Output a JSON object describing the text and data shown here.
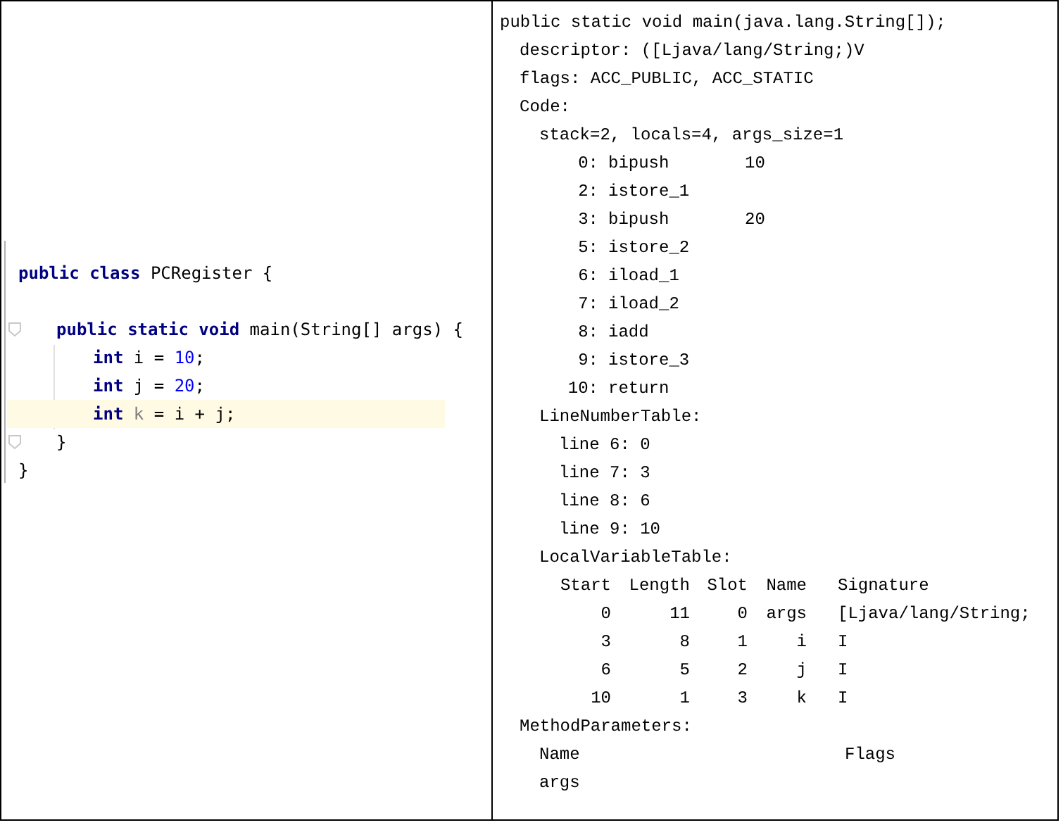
{
  "source_editor": {
    "lines": [
      {
        "kind": "top",
        "highlighted": false,
        "tokens": [
          {
            "text": "public ",
            "kind": "keyword"
          },
          {
            "text": "class ",
            "kind": "keyword"
          },
          {
            "text": "PCRegister {",
            "kind": "plain"
          }
        ]
      },
      {
        "kind": "blank",
        "highlighted": false
      },
      {
        "kind": "member",
        "highlighted": false,
        "fold": true,
        "tokens": [
          {
            "text": "public ",
            "kind": "keyword"
          },
          {
            "text": "static ",
            "kind": "keyword"
          },
          {
            "text": "void ",
            "kind": "keyword"
          },
          {
            "text": "main(String[] args) {",
            "kind": "plain"
          }
        ]
      },
      {
        "kind": "statement",
        "highlighted": false,
        "tokens": [
          {
            "text": "int ",
            "kind": "keyword"
          },
          {
            "text": "i = ",
            "kind": "plain"
          },
          {
            "text": "10",
            "kind": "number"
          },
          {
            "text": ";",
            "kind": "plain"
          }
        ]
      },
      {
        "kind": "statement",
        "highlighted": false,
        "tokens": [
          {
            "text": "int ",
            "kind": "keyword"
          },
          {
            "text": "j = ",
            "kind": "plain"
          },
          {
            "text": "20",
            "kind": "number"
          },
          {
            "text": ";",
            "kind": "plain"
          }
        ]
      },
      {
        "kind": "statement",
        "highlighted": true,
        "tokens": [
          {
            "text": "int ",
            "kind": "keyword"
          },
          {
            "text": "k",
            "kind": "unused"
          },
          {
            "text": " = i + j;",
            "kind": "plain"
          }
        ]
      },
      {
        "kind": "member",
        "highlighted": false,
        "fold": true,
        "tokens": [
          {
            "text": "}",
            "kind": "plain"
          }
        ]
      },
      {
        "kind": "top",
        "highlighted": false,
        "tokens": [
          {
            "text": "}",
            "kind": "plain"
          }
        ]
      }
    ]
  },
  "bytecode": {
    "signature": "public static void main(java.lang.String[]);",
    "attributes": [
      "descriptor: ([Ljava/lang/String;)V",
      "flags: ACC_PUBLIC, ACC_STATIC"
    ],
    "code": {
      "title": "Code:",
      "header": "stack=2, locals=4, args_size=1",
      "instructions": [
        {
          "offset": "0:",
          "opcode": "bipush",
          "operand": "10"
        },
        {
          "offset": "2:",
          "opcode": "istore_1"
        },
        {
          "offset": "3:",
          "opcode": "bipush",
          "operand": "20"
        },
        {
          "offset": "5:",
          "opcode": "istore_2"
        },
        {
          "offset": "6:",
          "opcode": "iload_1"
        },
        {
          "offset": "7:",
          "opcode": "iload_2"
        },
        {
          "offset": "8:",
          "opcode": "iadd"
        },
        {
          "offset": "9:",
          "opcode": "istore_3"
        },
        {
          "offset": "10:",
          "opcode": "return"
        }
      ],
      "line_number_table": {
        "title": "LineNumberTable:",
        "entries": [
          "line 6: 0",
          "line 7: 3",
          "line 8: 6",
          "line 9: 10"
        ]
      },
      "local_variable_table": {
        "title": "LocalVariableTable:",
        "columns": [
          "Start",
          "Length",
          "Slot",
          "Name",
          "Signature"
        ],
        "rows": [
          [
            "0",
            "11",
            "0",
            "args",
            "[Ljava/lang/String;"
          ],
          [
            "3",
            "8",
            "1",
            "i",
            "I"
          ],
          [
            "6",
            "5",
            "2",
            "j",
            "I"
          ],
          [
            "10",
            "1",
            "3",
            "k",
            "I"
          ]
        ]
      }
    },
    "method_parameters": {
      "title": "MethodParameters:",
      "columns": [
        "Name",
        "Flags"
      ],
      "rows": [
        [
          "args"
        ]
      ]
    }
  }
}
